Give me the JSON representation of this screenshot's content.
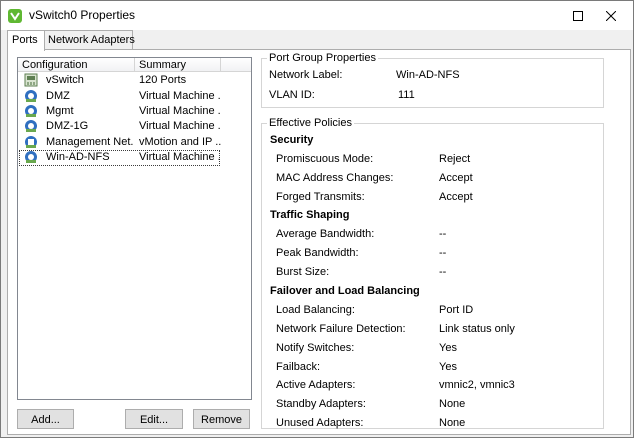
{
  "window": {
    "title": "vSwitch0 Properties",
    "icon": "vsphere-properties-icon"
  },
  "tabs": [
    {
      "label": "Ports",
      "active": true
    },
    {
      "label": "Network Adapters",
      "active": false
    }
  ],
  "ports_list": {
    "columns": [
      "Configuration",
      "Summary"
    ],
    "rows": [
      {
        "config": "vSwitch",
        "summary": "120 Ports",
        "icon": "vswitch-icon"
      },
      {
        "config": "DMZ",
        "summary": "Virtual Machine ...",
        "icon": "portgroup-icon"
      },
      {
        "config": "Mgmt",
        "summary": "Virtual Machine ...",
        "icon": "portgroup-icon"
      },
      {
        "config": "DMZ-1G",
        "summary": "Virtual Machine ...",
        "icon": "portgroup-icon"
      },
      {
        "config": "Management Net...",
        "summary": "vMotion and IP ...",
        "icon": "vmkernel-icon"
      },
      {
        "config": "Win-AD-NFS",
        "summary": "Virtual Machine ...",
        "icon": "portgroup-icon",
        "selected": true
      }
    ]
  },
  "buttons": {
    "add": "Add...",
    "edit": "Edit...",
    "remove": "Remove"
  },
  "port_group_properties": {
    "title": "Port Group Properties",
    "network_label": {
      "label": "Network Label:",
      "value": "Win-AD-NFS"
    },
    "vlan_id": {
      "label": "VLAN ID:",
      "value": "111"
    }
  },
  "effective_policies": {
    "title": "Effective Policies",
    "security": {
      "title": "Security",
      "items": [
        {
          "label": "Promiscuous Mode:",
          "value": "Reject"
        },
        {
          "label": "MAC Address Changes:",
          "value": "Accept"
        },
        {
          "label": "Forged Transmits:",
          "value": "Accept"
        }
      ]
    },
    "traffic_shaping": {
      "title": "Traffic Shaping",
      "items": [
        {
          "label": "Average Bandwidth:",
          "value": "--"
        },
        {
          "label": "Peak Bandwidth:",
          "value": "--"
        },
        {
          "label": "Burst Size:",
          "value": "--"
        }
      ]
    },
    "failover": {
      "title": "Failover and Load Balancing",
      "items": [
        {
          "label": "Load Balancing:",
          "value": "Port ID"
        },
        {
          "label": "Network Failure Detection:",
          "value": "Link status only"
        },
        {
          "label": "Notify Switches:",
          "value": "Yes"
        },
        {
          "label": "Failback:",
          "value": "Yes"
        },
        {
          "label": "Active Adapters:",
          "value": "vmnic2, vmnic3"
        },
        {
          "label": "Standby Adapters:",
          "value": "None"
        },
        {
          "label": "Unused Adapters:",
          "value": "None"
        }
      ]
    }
  },
  "colors": {
    "app_icon_green": "#5fb832",
    "portgroup_blue": "#2f6fc0"
  }
}
